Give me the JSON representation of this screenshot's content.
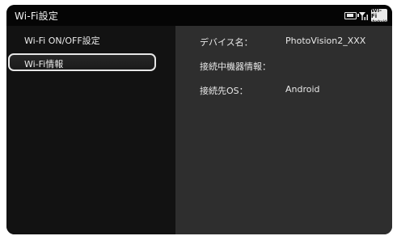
{
  "titlebar": {
    "title": "Wi-Fi設定",
    "status": {
      "battery_level": 0.85,
      "wifi_badge_top": "Wi-Fi",
      "wifi_badge_bottom": "Android"
    }
  },
  "sidebar": {
    "items": [
      {
        "label": "Wi-Fi ON/OFF設定",
        "selected": false
      },
      {
        "label": "Wi-Fi情報",
        "selected": true
      }
    ]
  },
  "detail": {
    "rows": [
      {
        "label": "デバイス名：",
        "value": "PhotoVision2_XXX"
      },
      {
        "label": "接続中機器情報：",
        "value": ""
      },
      {
        "label": "接続先OS：",
        "value": "Android"
      }
    ]
  },
  "icons": [
    "battery-icon",
    "signal-icon",
    "wifi-badge-icon"
  ]
}
